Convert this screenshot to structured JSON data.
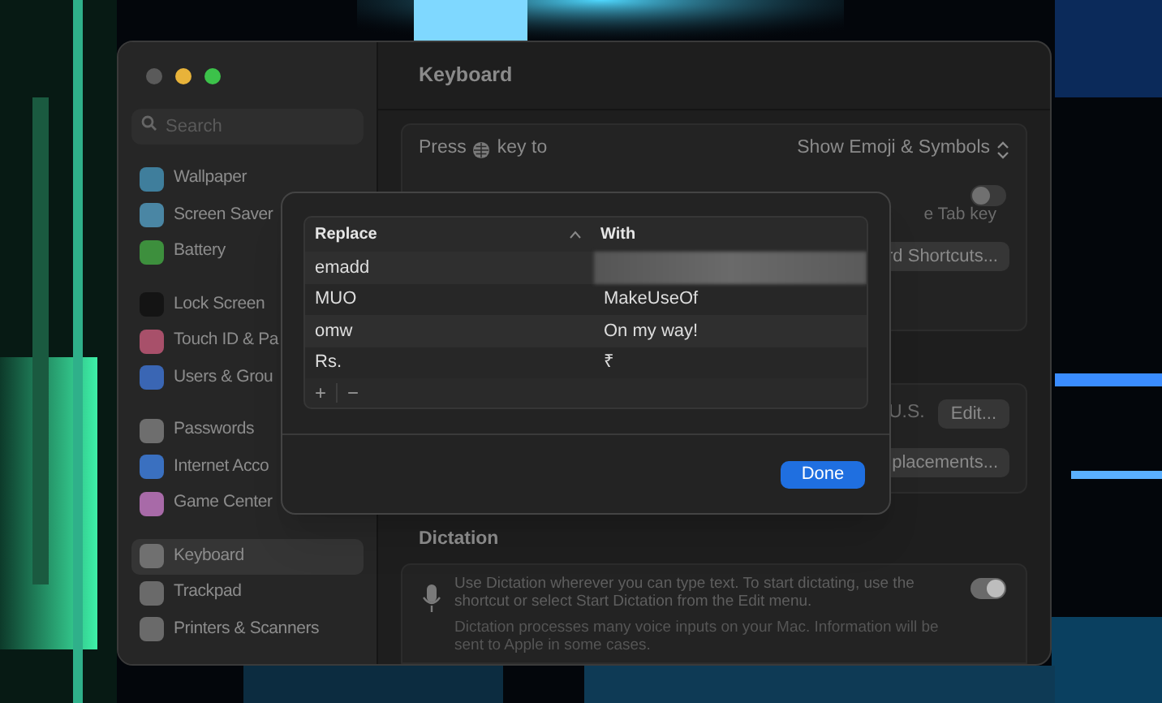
{
  "sidebar": {
    "search": {
      "placeholder": "Search"
    },
    "groups": [
      [
        {
          "label": "Wallpaper",
          "color": "#3f7e9c",
          "selected": false
        },
        {
          "label": "Screen Saver",
          "color": "#4a86a4",
          "selected": false
        },
        {
          "label": "Battery",
          "color": "#3d8f3d",
          "selected": false
        }
      ],
      [
        {
          "label": "Lock Screen",
          "color": "#141414",
          "selected": false
        },
        {
          "label": "Touch ID & Pa",
          "color": "#a8506a",
          "selected": false
        },
        {
          "label": "Users & Grou",
          "color": "#3a66b4",
          "selected": false
        }
      ],
      [
        {
          "label": "Passwords",
          "color": "#6e6e6e",
          "selected": false
        },
        {
          "label": "Internet Acco",
          "color": "#3a70c0",
          "selected": false
        },
        {
          "label": "Game Center",
          "color": "#a86aa8",
          "selected": false
        }
      ],
      [
        {
          "label": "Keyboard",
          "color": "#707070",
          "selected": true
        },
        {
          "label": "Trackpad",
          "color": "#6a6a6a",
          "selected": false
        },
        {
          "label": "Printers & Scanners",
          "color": "#6a6a6a",
          "selected": false
        }
      ]
    ]
  },
  "main": {
    "title": "Keyboard",
    "press_row": {
      "label_before": "Press",
      "label_after": "key to",
      "value": "Show Emoji & Symbols"
    },
    "tab_row": {
      "text": "e Tab key",
      "on": false
    },
    "shortcuts_button": "rd Shortcuts...",
    "input_row": {
      "value": "U.S.",
      "button": "Edit..."
    },
    "replacements_button": "placements...",
    "dictation": {
      "title": "Dictation",
      "text": "Use Dictation wherever you can type text. To start dictating, use the shortcut or select Start Dictation from the Edit menu.",
      "on": true,
      "note": "Dictation processes many voice inputs on your Mac. Information will be sent to Apple in some cases."
    }
  },
  "sheet": {
    "columns": [
      "Replace",
      "With"
    ],
    "rows": [
      {
        "replace": "emadd",
        "with": null
      },
      {
        "replace": "MUO",
        "with": "MakeUseOf"
      },
      {
        "replace": "omw",
        "with": "On my way!"
      },
      {
        "replace": "Rs.",
        "with": "₹"
      }
    ],
    "add": "+",
    "remove": "−",
    "done": "Done"
  }
}
